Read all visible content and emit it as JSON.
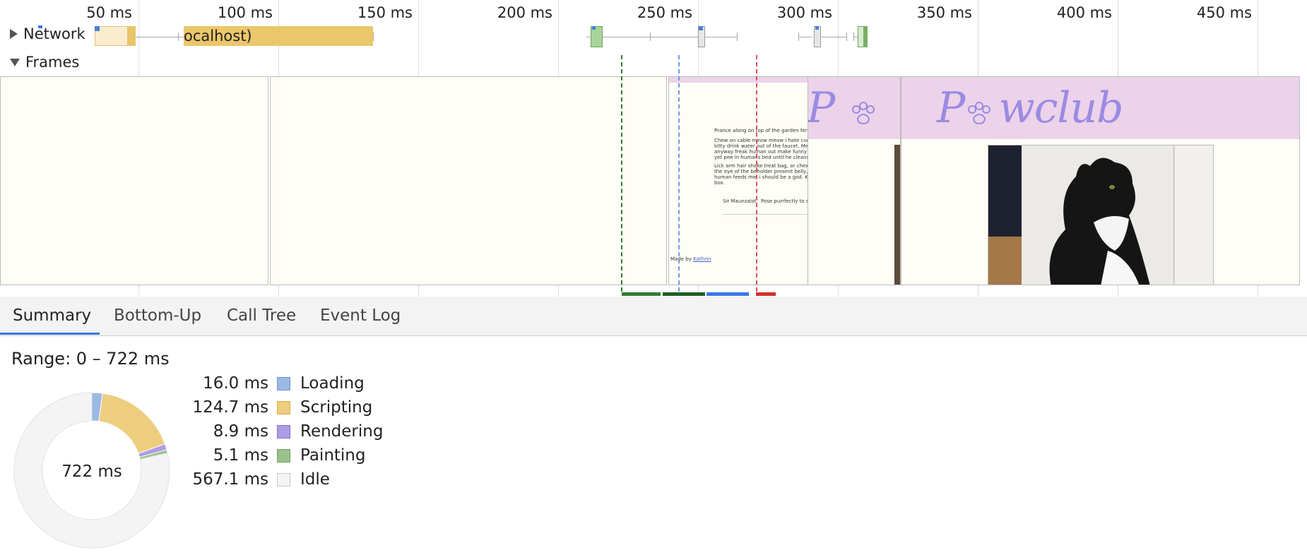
{
  "ruler": {
    "ticks": [
      "50 ms",
      "100 ms",
      "150 ms",
      "200 ms",
      "250 ms",
      "300 ms",
      "350 ms",
      "400 ms",
      "450 ms"
    ]
  },
  "network": {
    "label": "Network",
    "request_label": "ocalhost)"
  },
  "frames": {
    "label": "Frames"
  },
  "thumbnail": {
    "brand": "Pawclub",
    "brand_partial": "P",
    "paragraph1": "Prance along on top of the garden fence, annoy",
    "paragraph2_lines": [
      "Chew on cable meow meow i hate cucumber p",
      "kitty drink water out of the faucet. Meow loud",
      "anyway freak human out make funny noise m",
      "yet pee in humans bed until he cleans the litt"
    ],
    "paragraph3_lines": [
      "Lick arm hair shake treat bag, or chew on cab",
      "the eye of the beholder present belly, scratch",
      "human feeds me, i should be a god. Kitty run l",
      "box."
    ],
    "cat_name": "Sir Maunzalot",
    "cat_caption": "Pose purrfectly to show",
    "footer_text": "Made by",
    "footer_link": "Kathrin"
  },
  "tabs": [
    {
      "label": "Summary",
      "active": true
    },
    {
      "label": "Bottom-Up",
      "active": false
    },
    {
      "label": "Call Tree",
      "active": false
    },
    {
      "label": "Event Log",
      "active": false
    }
  ],
  "summary": {
    "range": "Range: 0 – 722 ms",
    "total": "722 ms",
    "categories": [
      {
        "value": "16.0 ms",
        "label": "Loading",
        "ms": 16.0,
        "color": "#9cb9e5",
        "border": "#6e93cf"
      },
      {
        "value": "124.7 ms",
        "label": "Scripting",
        "ms": 124.7,
        "color": "#ecce7e",
        "border": "#d8ae48"
      },
      {
        "value": "8.9 ms",
        "label": "Rendering",
        "ms": 8.9,
        "color": "#ae9ce5",
        "border": "#8a70d0"
      },
      {
        "value": "5.1 ms",
        "label": "Painting",
        "ms": 5.1,
        "color": "#9bc28b",
        "border": "#6fa35d"
      },
      {
        "value": "567.1 ms",
        "label": "Idle",
        "ms": 567.1,
        "color": "#f4f4f4",
        "border": "#c8c8c8"
      }
    ]
  }
}
